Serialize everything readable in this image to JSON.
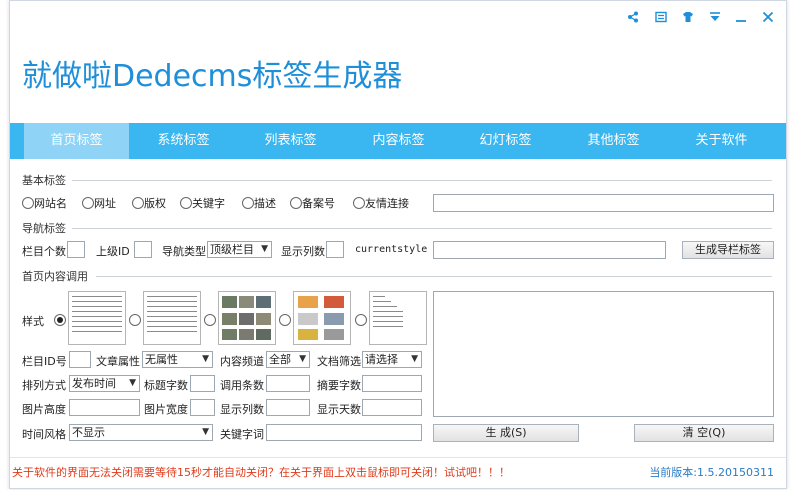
{
  "app": {
    "title": "就做啦Dedecms标签生成器"
  },
  "window_controls": [
    {
      "name": "share-icon",
      "glyph": "<"
    },
    {
      "name": "menu-icon",
      "glyph": "▤"
    },
    {
      "name": "skin-icon",
      "glyph": "♚"
    },
    {
      "name": "dropdown-icon",
      "glyph": "▾"
    },
    {
      "name": "minimize-icon",
      "glyph": "—"
    },
    {
      "name": "close-icon",
      "glyph": "✕"
    }
  ],
  "tabs": [
    "首页标签",
    "系统标签",
    "列表标签",
    "内容标签",
    "幻灯标签",
    "其他标签",
    "关于软件"
  ],
  "basic": {
    "section": "基本标签",
    "radios": [
      "网站名",
      "网址",
      "版权",
      "关键字",
      "描述",
      "备案号",
      "友情连接"
    ]
  },
  "nav": {
    "section": "导航标签",
    "count_label": "栏目个数",
    "parent_label": "上级ID",
    "type_label": "导航类型",
    "type_value": "顶级栏目",
    "cols_label": "显示列数",
    "current_style": "currentstyle",
    "generate_btn": "生成导栏标签"
  },
  "home": {
    "section": "首页内容调用",
    "style_label": "样式",
    "column_id_label": "栏目ID号",
    "attr_label": "文章属性",
    "attr_value": "无属性",
    "channel_label": "内容频道",
    "channel_value": "全部",
    "filter_label": "文档筛选",
    "filter_value": "请选择",
    "order_label": "排列方式",
    "order_value": "发布时间",
    "title_len_label": "标题字数",
    "count_label": "调用条数",
    "summary_label": "摘要字数",
    "img_h_label": "图片高度",
    "img_w_label": "图片宽度",
    "cols_label": "显示列数",
    "days_label": "显示天数",
    "time_style_label": "时间风格",
    "time_style_value": "不显示",
    "keyword_label": "关键字词",
    "generate_btn": "生 成(S)",
    "clear_btn": "清 空(Q)"
  },
  "status": {
    "notice": "关于软件的界面无法关闭需要等待15秒才能自动关闭？在关于界面上双击鼠标即可关闭！试试吧！！！",
    "version": "当前版本:1.5.20150311"
  },
  "colors": {
    "accent": "#3ab6f0",
    "title": "#1e8fd8",
    "active_tab": "#8fd3f7",
    "notice": "#e03a1a"
  }
}
